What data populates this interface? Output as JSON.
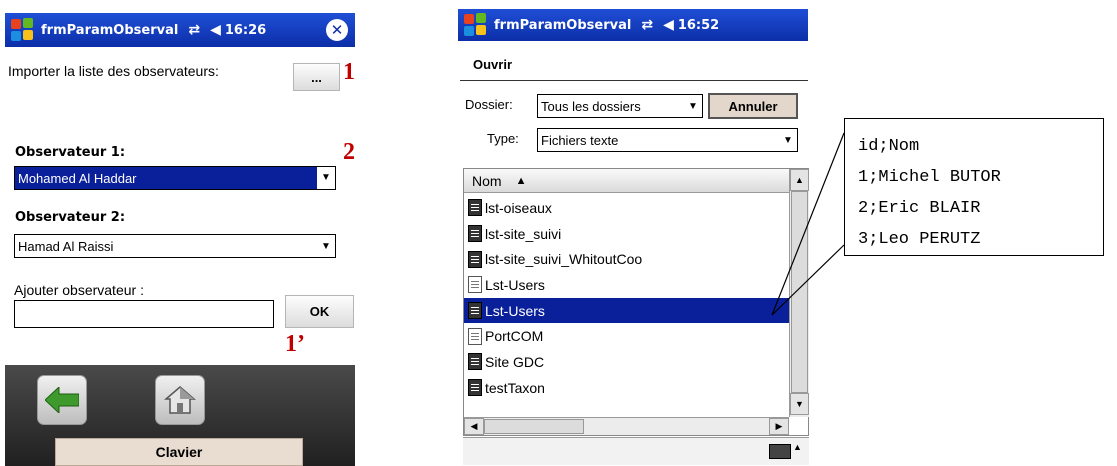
{
  "left": {
    "titlebar": {
      "title": "frmParamObserval",
      "time": "16:26"
    },
    "import_label": "Importer la liste des observateurs:",
    "browse_label": "...",
    "marker_1": "1",
    "marker_2": "2",
    "marker_1b": "1’",
    "observer1": {
      "label": "Observateur 1:",
      "value": "Mohamed Al Haddar"
    },
    "observer2": {
      "label": "Observateur 2:",
      "value": "Hamad Al Raissi"
    },
    "add": {
      "label": "Ajouter observateur :",
      "value": "",
      "ok_label": "OK"
    },
    "softkey_label": "Clavier"
  },
  "right": {
    "titlebar": {
      "title": "frmParamObserval",
      "time": "16:52"
    },
    "menu_title": "Ouvrir",
    "folder": {
      "label": "Dossier:",
      "value": "Tous les dossiers",
      "cancel_label": "Annuler"
    },
    "type": {
      "label": "Type:",
      "value": "Fichiers texte"
    },
    "column_header": "Nom",
    "sort_arrow": "▲",
    "files": [
      {
        "name": "lst-oiseaux",
        "selected": false,
        "dark": true
      },
      {
        "name": "lst-site_suivi",
        "selected": false,
        "dark": true
      },
      {
        "name": "lst-site_suivi_WhitoutCoo",
        "selected": false,
        "dark": true
      },
      {
        "name": "Lst-Users",
        "selected": false,
        "dark": false
      },
      {
        "name": "Lst-Users",
        "selected": true,
        "dark": true
      },
      {
        "name": "PortCOM",
        "selected": false,
        "dark": false
      },
      {
        "name": "Site GDC",
        "selected": false,
        "dark": true
      },
      {
        "name": "testTaxon",
        "selected": false,
        "dark": true
      }
    ]
  },
  "file_content": [
    "id;Nom",
    "1;Michel BUTOR",
    "2;Eric BLAIR",
    "3;Leo PERUTZ"
  ],
  "colors": {
    "titlebar": "#0c2ea8",
    "selection": "#0a1f9a",
    "marker": "#c00000",
    "softkey": "#e9dcd0"
  }
}
